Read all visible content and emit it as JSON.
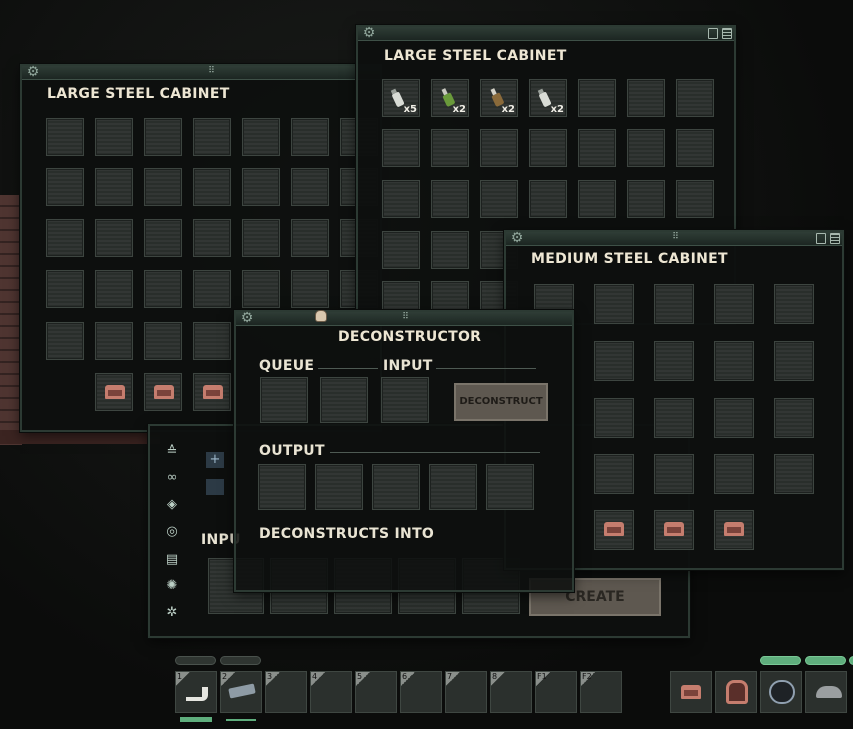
{
  "colors": {
    "window_bg": "#0e100f",
    "window_border": "#2c3a33",
    "title_text": "#ede6d3",
    "button_bg": "#5e5850",
    "chair_item": "#c57d6e",
    "status_green": "#5fae7d"
  },
  "windows": {
    "large_cabinet_left": {
      "title": "LARGE STEEL CABINET"
    },
    "large_cabinet_top": {
      "title": "LARGE STEEL CABINET",
      "items": [
        {
          "icon": "fire-extinguisher-icon",
          "count": "x5"
        },
        {
          "icon": "bottle-icon",
          "count": "x2"
        },
        {
          "icon": "bottle-icon",
          "count": "x2"
        },
        {
          "icon": "fire-extinguisher-icon",
          "count": "x2"
        }
      ]
    },
    "medium_cabinet": {
      "title": "MEDIUM STEEL CABINET"
    },
    "fabricator": {
      "input_label": "INPU",
      "create_label": "CREATE"
    },
    "deconstructor": {
      "title": "DECONSTRUCTOR",
      "queue_label": "QUEUE",
      "input_label": "INPUT",
      "button_label": "DECONSTRUCT",
      "output_label": "OUTPUT",
      "deconstructs_into_label": "DECONSTRUCTS INTO"
    }
  },
  "hotbar": {
    "slots": [
      {
        "key": "1",
        "icon": "pipe-icon"
      },
      {
        "key": "2",
        "icon": "revolver-icon"
      },
      {
        "key": "3",
        "icon": ""
      },
      {
        "key": "4",
        "icon": ""
      },
      {
        "key": "5",
        "icon": ""
      },
      {
        "key": "6",
        "icon": ""
      },
      {
        "key": "7",
        "icon": ""
      },
      {
        "key": "8",
        "icon": ""
      },
      {
        "key": "F1",
        "icon": ""
      },
      {
        "key": "F2",
        "icon": ""
      }
    ],
    "right_slots": [
      "chair-icon",
      "helmet-icon",
      "diving-mask-icon",
      "cap-icon"
    ]
  }
}
